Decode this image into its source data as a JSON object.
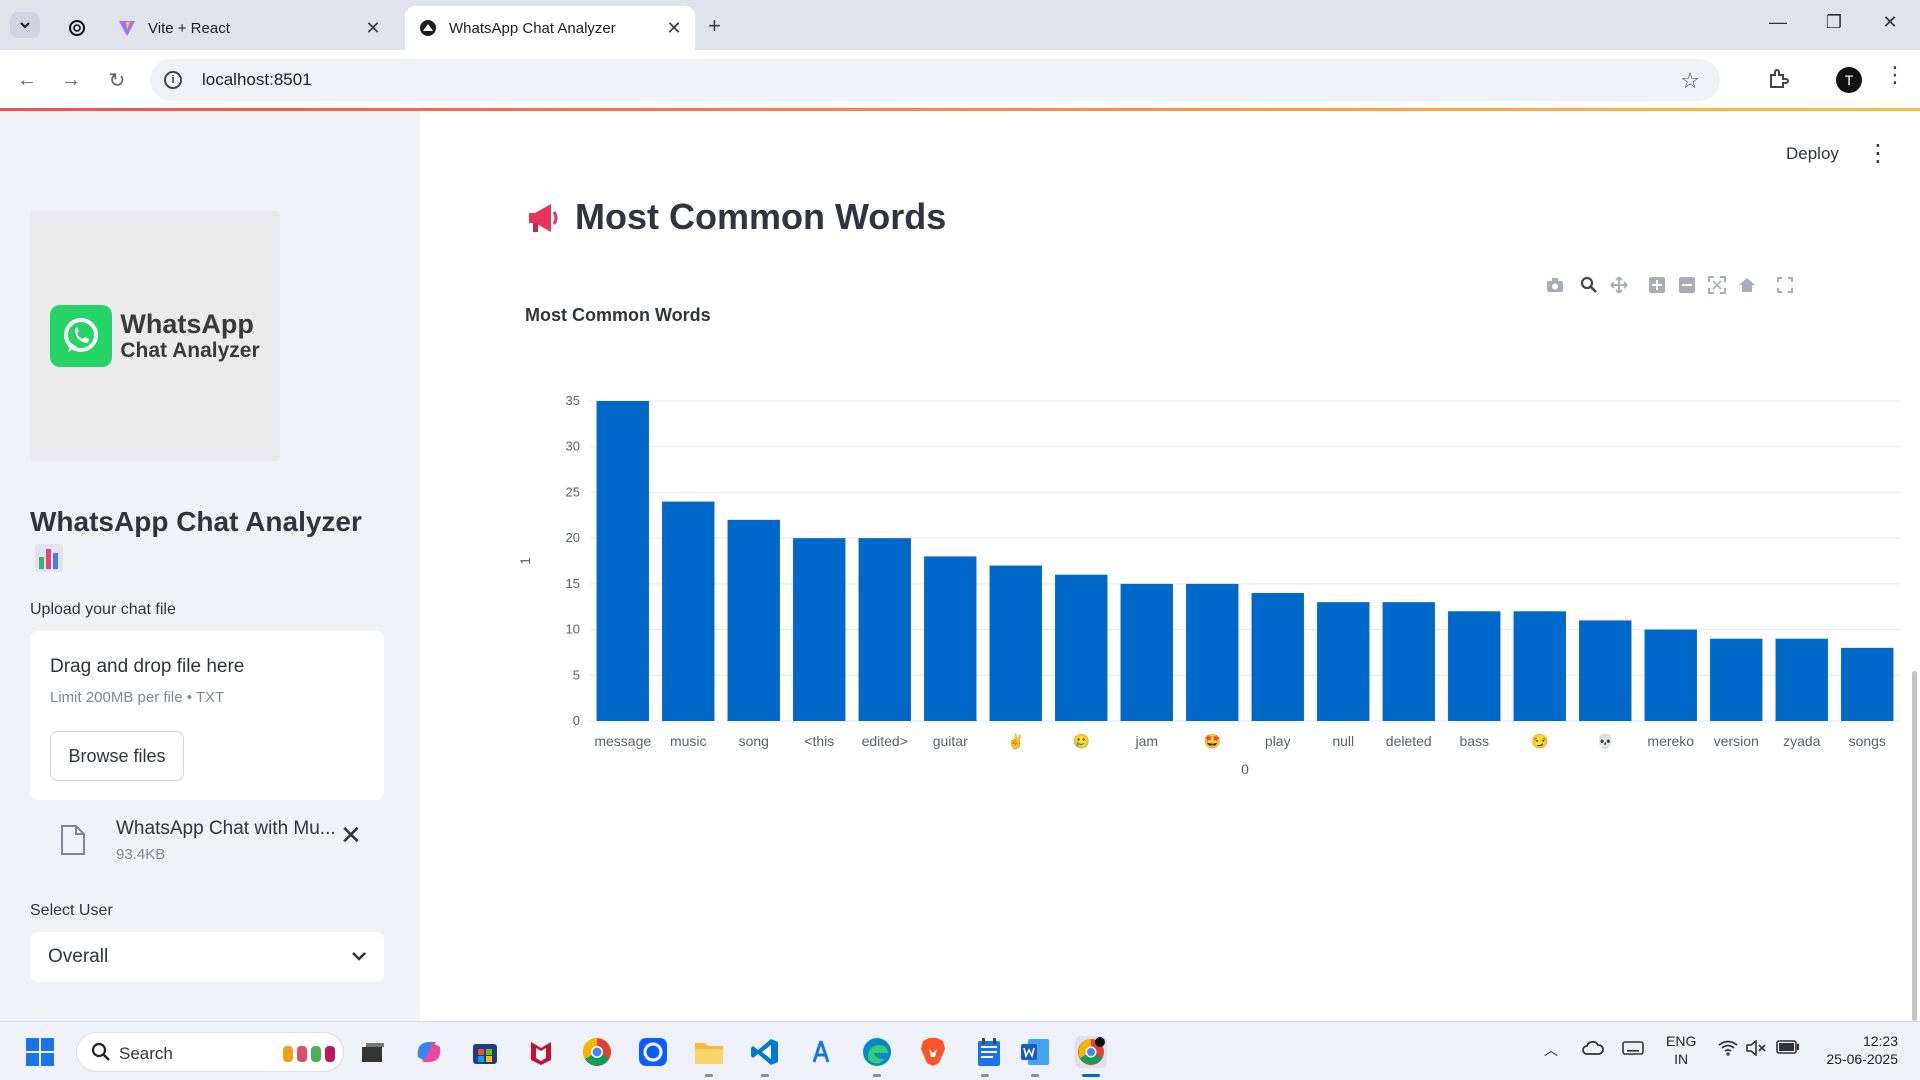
{
  "browser": {
    "tabs": [
      {
        "label": "Vite + React"
      },
      {
        "label": "WhatsApp Chat Analyzer"
      }
    ],
    "url": "localhost:8501"
  },
  "sidebar": {
    "logo": {
      "line1": "WhatsApp",
      "line2": "Chat Analyzer"
    },
    "title": "WhatsApp Chat Analyzer",
    "upload_label": "Upload your chat file",
    "dropzone": {
      "main_text": "Drag and drop file here",
      "sub_text": "Limit 200MB per file • TXT",
      "browse_label": "Browse files"
    },
    "file": {
      "name": "WhatsApp Chat with Mu...",
      "size": "93.4KB"
    },
    "select_label": "Select User",
    "select_value": "Overall"
  },
  "main": {
    "deploy_label": "Deploy",
    "section_title": "Most Common Words",
    "chart_title": "Most Common Words"
  },
  "chart_data": {
    "type": "bar",
    "title": "Most Common Words",
    "xlabel": "0",
    "ylabel": "1",
    "categories": [
      "message",
      "music",
      "song",
      "<this",
      "edited>",
      "guitar",
      "✌️",
      "🥲",
      "jam",
      "🤩",
      "play",
      "null",
      "deleted",
      "bass",
      "😏",
      "💀",
      "mereko",
      "version",
      "zyada",
      "songs"
    ],
    "values": [
      35,
      24,
      22,
      20,
      20,
      18,
      17,
      16,
      15,
      15,
      14,
      13,
      13,
      12,
      12,
      11,
      10,
      9,
      9,
      8
    ],
    "ylim": [
      0,
      35
    ],
    "yticks": [
      0,
      5,
      10,
      15,
      20,
      25,
      30,
      35
    ],
    "color": "#0068c9",
    "grid": true
  },
  "taskbar": {
    "search_label": "Search",
    "lang_line1": "ENG",
    "lang_line2": "IN",
    "time": "12:23",
    "date": "25-06-2025"
  },
  "colors": {
    "accent": "#0068c9",
    "sidebar_bg": "#f0f2f6",
    "tab_strip": "#dfe3ea"
  }
}
